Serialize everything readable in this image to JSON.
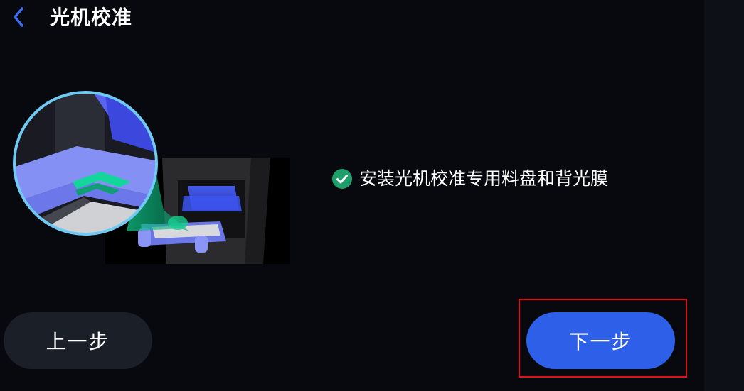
{
  "header": {
    "back_icon": "chevron-left-icon",
    "title": "光机校准"
  },
  "step": {
    "status_icon": "check-circle-icon",
    "status_color": "#1e9e6a",
    "text": "安装光机校准专用料盘和背光膜"
  },
  "footer": {
    "prev_label": "上一步",
    "next_label": "下一步"
  },
  "colors": {
    "accent": "#2d5fe8",
    "highlight_border": "#d9141b",
    "back_icon": "#3f6ef5"
  }
}
